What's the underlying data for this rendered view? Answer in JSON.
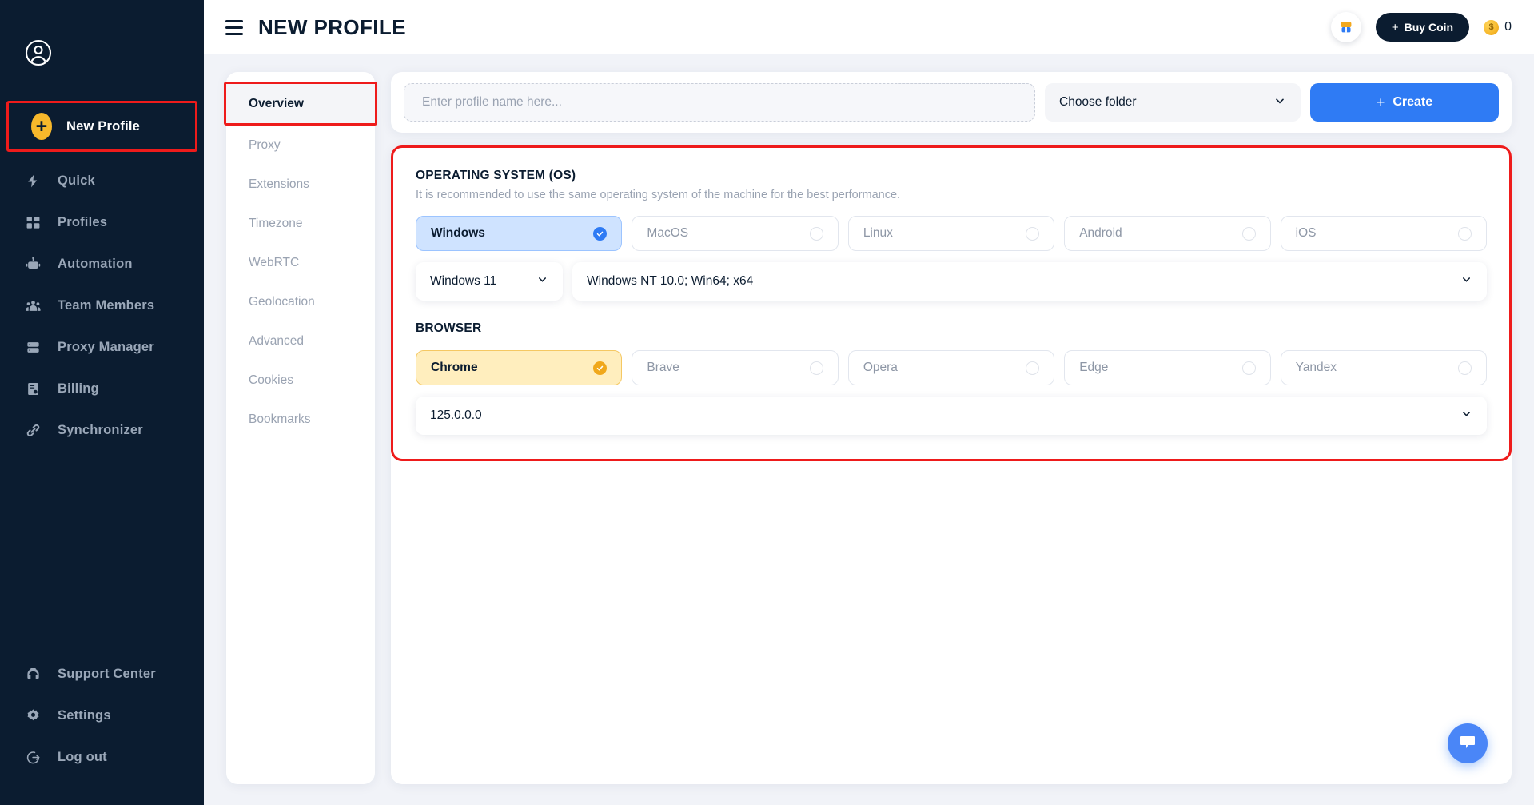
{
  "sidebar": {
    "avatar_icon": "user-circle-icon",
    "primary": {
      "label": "New Profile",
      "icon": "plus-circle-icon"
    },
    "items": [
      {
        "label": "Quick",
        "icon": "lightning-icon"
      },
      {
        "label": "Profiles",
        "icon": "grid-icon"
      },
      {
        "label": "Automation",
        "icon": "robot-icon"
      },
      {
        "label": "Team Members",
        "icon": "people-icon"
      },
      {
        "label": "Proxy Manager",
        "icon": "server-icon"
      },
      {
        "label": "Billing",
        "icon": "invoice-icon"
      },
      {
        "label": "Synchronizer",
        "icon": "link-icon"
      }
    ],
    "bottom_items": [
      {
        "label": "Support Center",
        "icon": "headset-icon"
      },
      {
        "label": "Settings",
        "icon": "gear-icon"
      },
      {
        "label": "Log out",
        "icon": "logout-icon"
      }
    ]
  },
  "topbar": {
    "menu_icon": "hamburger-icon",
    "title": "NEW PROFILE",
    "gift_icon": "gift-avatar-icon",
    "buy_coin_label": "Buy Coin",
    "buy_coin_plus": "+",
    "coin_symbol": "$",
    "coin_count": "0"
  },
  "tabs": [
    {
      "label": "Overview",
      "active": true
    },
    {
      "label": "Proxy",
      "active": false
    },
    {
      "label": "Extensions",
      "active": false
    },
    {
      "label": "Timezone",
      "active": false
    },
    {
      "label": "WebRTC",
      "active": false
    },
    {
      "label": "Geolocation",
      "active": false
    },
    {
      "label": "Advanced",
      "active": false
    },
    {
      "label": "Cookies",
      "active": false
    },
    {
      "label": "Bookmarks",
      "active": false
    }
  ],
  "form": {
    "profile_name_value": "",
    "profile_name_placeholder": "Enter profile name here...",
    "folder_label": "Choose folder",
    "create_label": "Create",
    "create_plus": "+"
  },
  "os_section": {
    "title": "OPERATING SYSTEM (OS)",
    "description": "It is recommended to use the same operating system of the machine for the best performance.",
    "options": [
      {
        "label": "Windows",
        "selected": true
      },
      {
        "label": "MacOS",
        "selected": false
      },
      {
        "label": "Linux",
        "selected": false
      },
      {
        "label": "Android",
        "selected": false
      },
      {
        "label": "iOS",
        "selected": false
      }
    ],
    "version_value": "Windows 11",
    "user_agent_value": "Windows NT 10.0; Win64; x64"
  },
  "browser_section": {
    "title": "BROWSER",
    "options": [
      {
        "label": "Chrome",
        "selected": true
      },
      {
        "label": "Brave",
        "selected": false
      },
      {
        "label": "Opera",
        "selected": false
      },
      {
        "label": "Edge",
        "selected": false
      },
      {
        "label": "Yandex",
        "selected": false
      }
    ],
    "version_value": "125.0.0.0"
  },
  "chat": {
    "icon": "chat-bubble-icon"
  },
  "colors": {
    "sidebar_bg": "#0b1c30",
    "accent_blue": "#2f7bf4",
    "accent_amber": "#f7b82b",
    "highlight_red": "#ee1b1b",
    "page_bg": "#f1f3f8"
  }
}
